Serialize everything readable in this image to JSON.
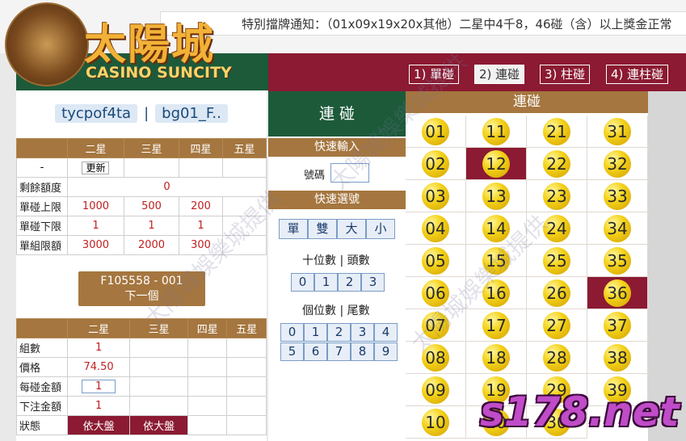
{
  "logo": {
    "title": "太陽城",
    "subtitle": "CASINO SUNCITY"
  },
  "notice": "特別擋牌通知：（01x09x19x20x其他）二星中4千8，46碰（含）以上獎金正常",
  "modes": [
    "1) 單碰",
    "2) 連碰",
    "3) 柱碰",
    "4) 連柱碰"
  ],
  "active_mode_index": 1,
  "user": {
    "account": "tycpof4ta",
    "separator": "|",
    "group": "bg01_F.."
  },
  "limits": {
    "headers": [
      "二星",
      "三星",
      "四星",
      "五星"
    ],
    "update_label": "更新",
    "dash": "-",
    "rows": [
      {
        "label": "剩餘額度",
        "values": [
          "0"
        ]
      },
      {
        "label": "單碰上限",
        "values": [
          "1000",
          "500",
          "200",
          ""
        ]
      },
      {
        "label": "單碰下限",
        "values": [
          "1",
          "1",
          "1",
          ""
        ]
      },
      {
        "label": "單組限額",
        "values": [
          "3000",
          "2000",
          "300",
          ""
        ]
      }
    ]
  },
  "product_button": {
    "line1": "F105558 - 001",
    "line2": "下一個"
  },
  "order": {
    "headers": [
      "二星",
      "三星",
      "四星",
      "五星"
    ],
    "rows": [
      {
        "label": "組數",
        "value": "1"
      },
      {
        "label": "價格",
        "value": "74.50"
      },
      {
        "label": "每碰金額",
        "value": "1"
      },
      {
        "label": "下注金額",
        "value": "1"
      },
      {
        "label": "狀態",
        "values": [
          "依大盤",
          "依大盤"
        ]
      }
    ]
  },
  "middle": {
    "title": "連 碰",
    "quick_input": "快速輸入",
    "code_label": "號碼",
    "quick_select": "快速選號",
    "type_buttons": [
      "單",
      "雙",
      "大",
      "小"
    ],
    "tens_label": "十位數 | 頭數",
    "tens_buttons": [
      "0",
      "1",
      "2",
      "3"
    ],
    "units_label": "個位數 | 尾數",
    "units_buttons": [
      "0",
      "1",
      "2",
      "3",
      "4",
      "5",
      "6",
      "7",
      "8",
      "9"
    ]
  },
  "numbers": {
    "header": "連碰",
    "grid": [
      [
        "01",
        "11",
        "21",
        "31"
      ],
      [
        "02",
        "12",
        "22",
        "32"
      ],
      [
        "03",
        "13",
        "23",
        "33"
      ],
      [
        "04",
        "14",
        "24",
        "34"
      ],
      [
        "05",
        "15",
        "25",
        "35"
      ],
      [
        "06",
        "16",
        "26",
        "36"
      ],
      [
        "07",
        "17",
        "27",
        "37"
      ],
      [
        "08",
        "18",
        "28",
        "38"
      ],
      [
        "09",
        "19",
        "29",
        "39"
      ],
      [
        "10",
        "20",
        "30",
        ""
      ]
    ],
    "selected": [
      "12",
      "36"
    ]
  },
  "watermark": "s178.net",
  "watermark_text": "太陽城娛樂城提供"
}
